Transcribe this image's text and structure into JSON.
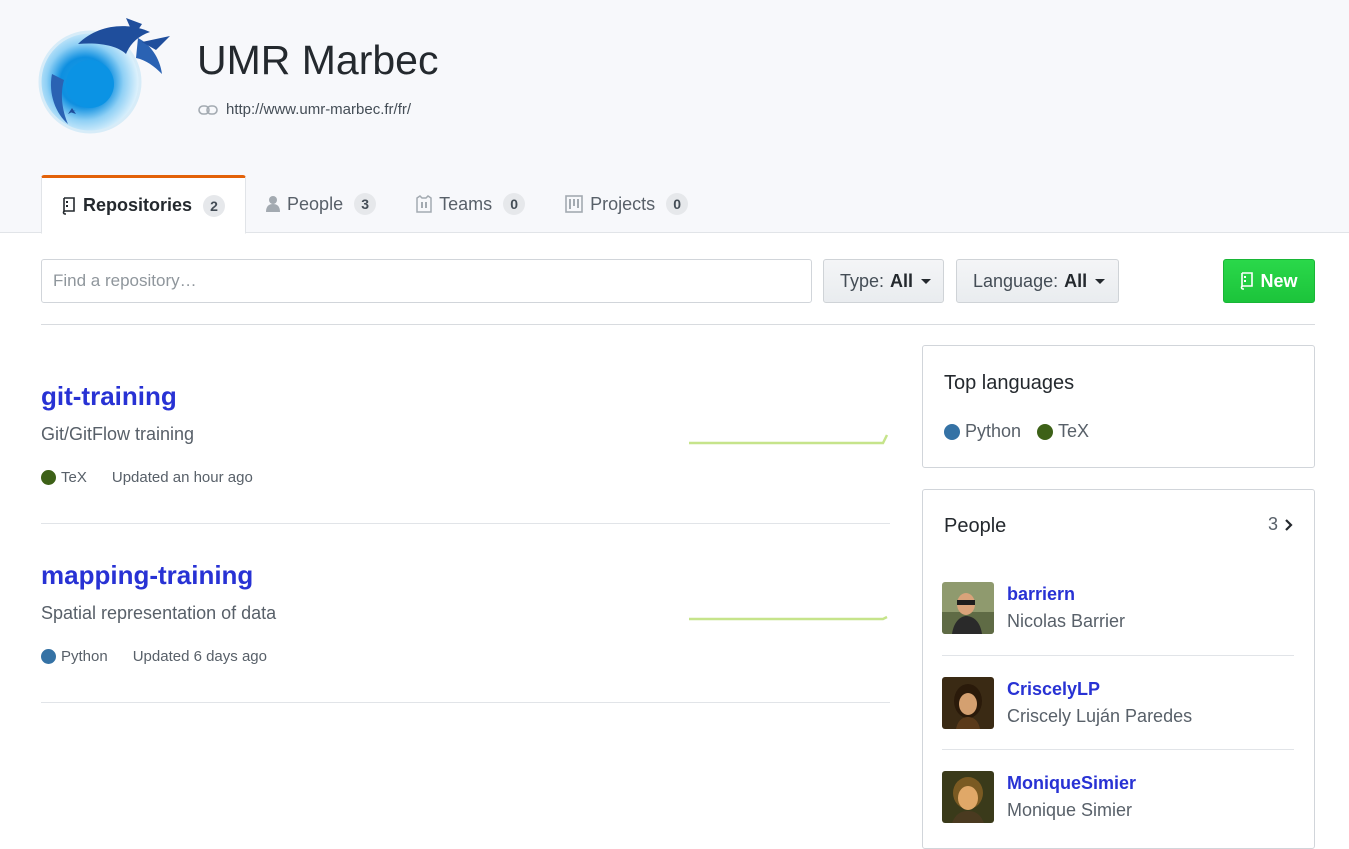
{
  "org": {
    "name": "UMR Marbec",
    "url": "http://www.umr-marbec.fr/fr/"
  },
  "tabs": [
    {
      "label": "Repositories",
      "count": "2",
      "selected": true,
      "icon": "repo-icon"
    },
    {
      "label": "People",
      "count": "3",
      "selected": false,
      "icon": "person-icon"
    },
    {
      "label": "Teams",
      "count": "0",
      "selected": false,
      "icon": "jersey-icon"
    },
    {
      "label": "Projects",
      "count": "0",
      "selected": false,
      "icon": "project-icon"
    }
  ],
  "filters": {
    "search_placeholder": "Find a repository…",
    "type_label": "Type:",
    "type_value": "All",
    "language_label": "Language:",
    "language_value": "All",
    "new_label": "New"
  },
  "repositories": [
    {
      "name": "git-training",
      "description": "Git/GitFlow training",
      "language": "TeX",
      "language_color": "#3D6117",
      "updated": "Updated an hour ago"
    },
    {
      "name": "mapping-training",
      "description": "Spatial representation of data",
      "language": "Python",
      "language_color": "#3572A5",
      "updated": "Updated 6 days ago"
    }
  ],
  "top_languages": {
    "title": "Top languages",
    "items": [
      {
        "name": "Python",
        "color": "#3572A5"
      },
      {
        "name": "TeX",
        "color": "#3D6117"
      }
    ]
  },
  "people": {
    "title": "People",
    "count": "3",
    "members": [
      {
        "login": "barriern",
        "name": "Nicolas Barrier"
      },
      {
        "login": "CriscelyLP",
        "name": "Criscely Luján Paredes"
      },
      {
        "login": "MoniqueSimier",
        "name": "Monique Simier"
      }
    ]
  },
  "colors": {
    "accent_tab": "#e36209",
    "link": "#2832d4",
    "new_button": "#28d046",
    "sparkline": "#c6e48b"
  }
}
